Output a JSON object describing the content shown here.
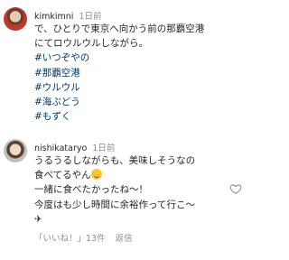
{
  "comments": [
    {
      "username": "kimkimni",
      "time": "1日前",
      "lines": [
        "で、ひとりで東京へ向かう前の那覇空港",
        "にてロウルウルしながら。"
      ],
      "hashtags": [
        "#いつぞやの",
        "#那覇空港",
        "#ウルウル",
        "#海ぶどう",
        "#もずく"
      ]
    },
    {
      "username": "nishikataryo",
      "time": "1日前",
      "lines": [
        "うるうるしながらも、美味しそうなの",
        "食べてるやん",
        "一緒に食べたかったね〜！",
        "今度はも少し時間に余裕作って行こ〜",
        "✈"
      ],
      "footer": {
        "like_label": "「いいね！」13件",
        "reply_label": "返信"
      }
    }
  ],
  "icons": {
    "emoji": "grinning-sweat-emoji",
    "heart": "heart-outline-icon",
    "plane": "airplane-icon"
  }
}
